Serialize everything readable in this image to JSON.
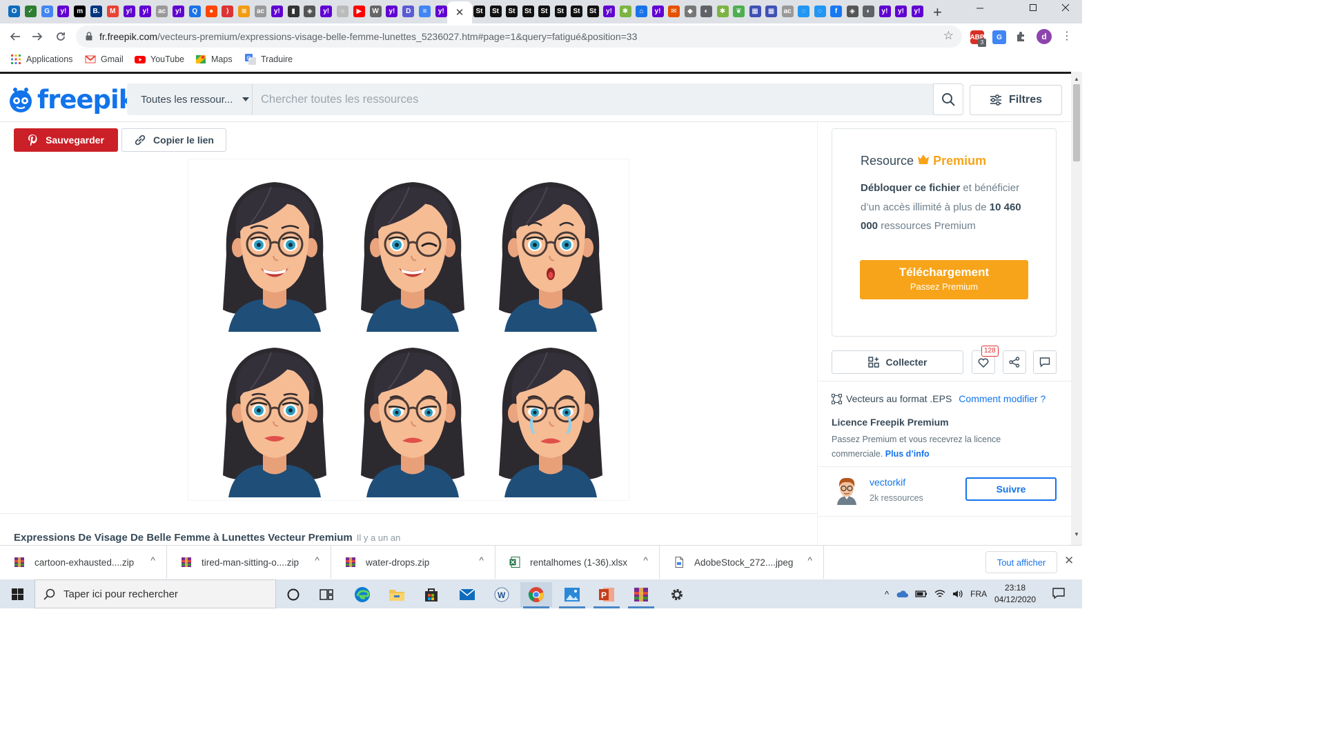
{
  "browser": {
    "tab_close": "✕",
    "new_tab": "+",
    "url_domain": "fr.freepik.com",
    "url_path": "/vecteurs-premium/expressions-visage-belle-femme-lunettes_5236027.htm#page=1&query=fatigué&position=33",
    "ext_badge": "3",
    "profile_letter": "d"
  },
  "bookmarks": [
    {
      "label": "Applications"
    },
    {
      "label": "Gmail"
    },
    {
      "label": "YouTube"
    },
    {
      "label": "Maps"
    },
    {
      "label": "Traduire"
    }
  ],
  "site": {
    "logo_text": "freepik",
    "type_select": "Toutes les ressour...",
    "search_placeholder": "Chercher toutes les ressources",
    "filters_label": "Filtres",
    "save_label": "Sauvegarder",
    "copy_label": "Copier le lien",
    "resource_title": "Expressions De Visage De Belle Femme à Lunettes Vecteur Premium",
    "resource_age": "Il y a un an"
  },
  "sidebar": {
    "premium_prefix": "Resource",
    "premium_word": "Premium",
    "unlock_bold": "Débloquer ce fichier",
    "unlock_rest1": " et bénéficier d’un accès illimité à plus de ",
    "unlock_count": "10 460 000",
    "unlock_rest2": " ressources Premium",
    "download_main": "Téléchargement",
    "download_sub": "Passez Premium",
    "collect_label": "Collecter",
    "like_count": "128",
    "format_text": "Vecteurs au format .EPS",
    "edit_link": "Comment modifier ?",
    "license_title": "Licence Freepik Premium",
    "license_text": "Passez Premium et vous recevrez la licence commerciale. ",
    "more_info": "Plus d’info",
    "author_name": "vectorkif",
    "author_count": "2k ressources",
    "follow_label": "Suivre"
  },
  "downloads": {
    "items": [
      {
        "name": "cartoon-exhausted....zip"
      },
      {
        "name": "tired-man-sitting-o....zip"
      },
      {
        "name": "water-drops.zip"
      },
      {
        "name": "rentalhomes (1-36).xlsx"
      },
      {
        "name": "AdobeStock_272....jpeg"
      }
    ],
    "show_all": "Tout afficher"
  },
  "taskbar": {
    "search_placeholder": "Taper ici pour rechercher",
    "lang": "FRA",
    "time": "23:18",
    "date": "04/12/2020"
  },
  "colors": {
    "freepik_blue": "#1273eb",
    "pinterest_red": "#cb2027",
    "premium_orange": "#f7a41a"
  }
}
